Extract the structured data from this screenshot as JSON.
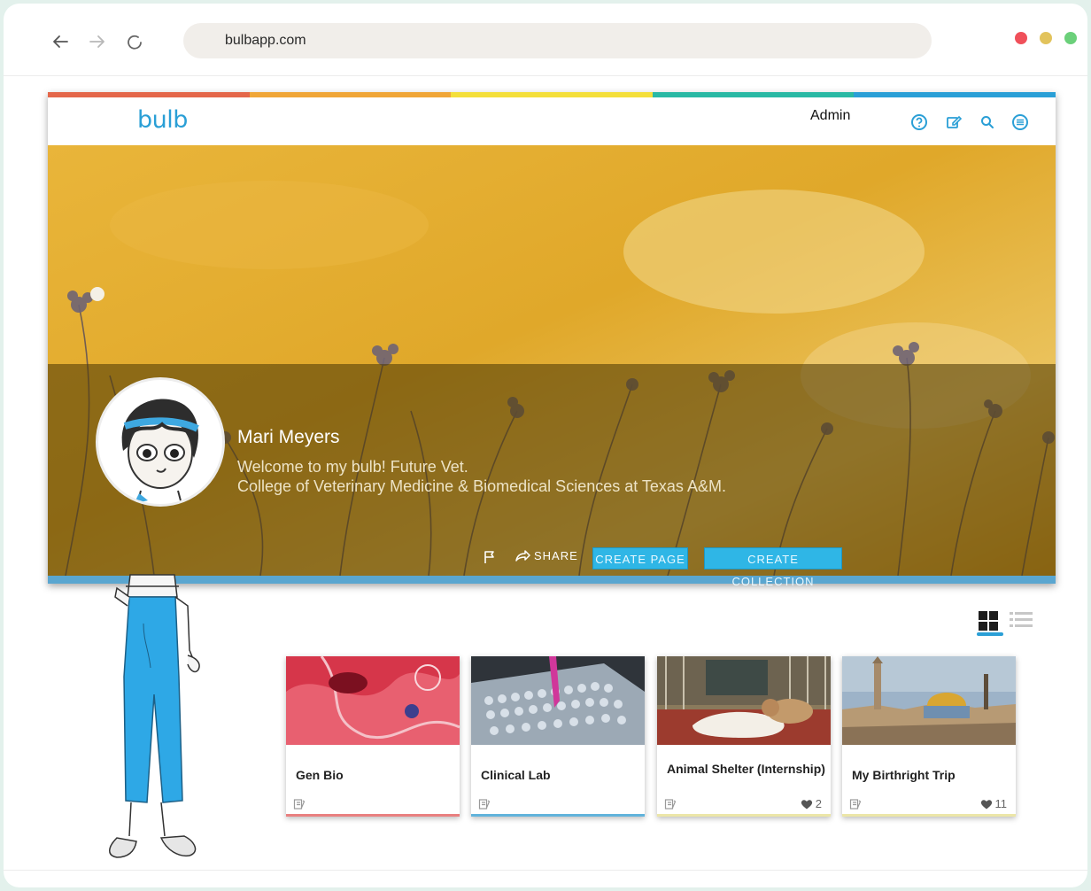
{
  "browser": {
    "url": "bulbapp.com",
    "window_dots": [
      "#f0505a",
      "#e2c35c",
      "#6bd07a"
    ]
  },
  "app": {
    "logo": "bulb",
    "admin_label": "Admin",
    "rainbow_colors": [
      "#e4674a",
      "#f0a637",
      "#f4df3a",
      "#29b9a4",
      "#2a9fd6"
    ],
    "header_icons": [
      "help-icon",
      "edit-icon",
      "search-icon",
      "menu-icon"
    ]
  },
  "profile": {
    "name": "Mari Meyers",
    "bio_line1": "Welcome to my bulb! Future Vet.",
    "bio_line2": "College of Veterinary Medicine & Biomedical Sciences at Texas A&M."
  },
  "actions": {
    "share_label": "SHARE",
    "create_page_label": "CREATE PAGE",
    "create_collection_label": "CREATE COLLECTION"
  },
  "view_toggle": {
    "selected": "grid"
  },
  "cards": [
    {
      "title": "Gen Bio",
      "likes": null,
      "accent": "#e98080"
    },
    {
      "title": "Clinical Lab",
      "likes": null,
      "accent": "#62b4dc"
    },
    {
      "title": "Animal Shelter (Internship)",
      "likes": "2",
      "accent": "#ece6a8"
    },
    {
      "title": "My Birthright Trip",
      "likes": "11",
      "accent": "#ece6a8"
    }
  ]
}
